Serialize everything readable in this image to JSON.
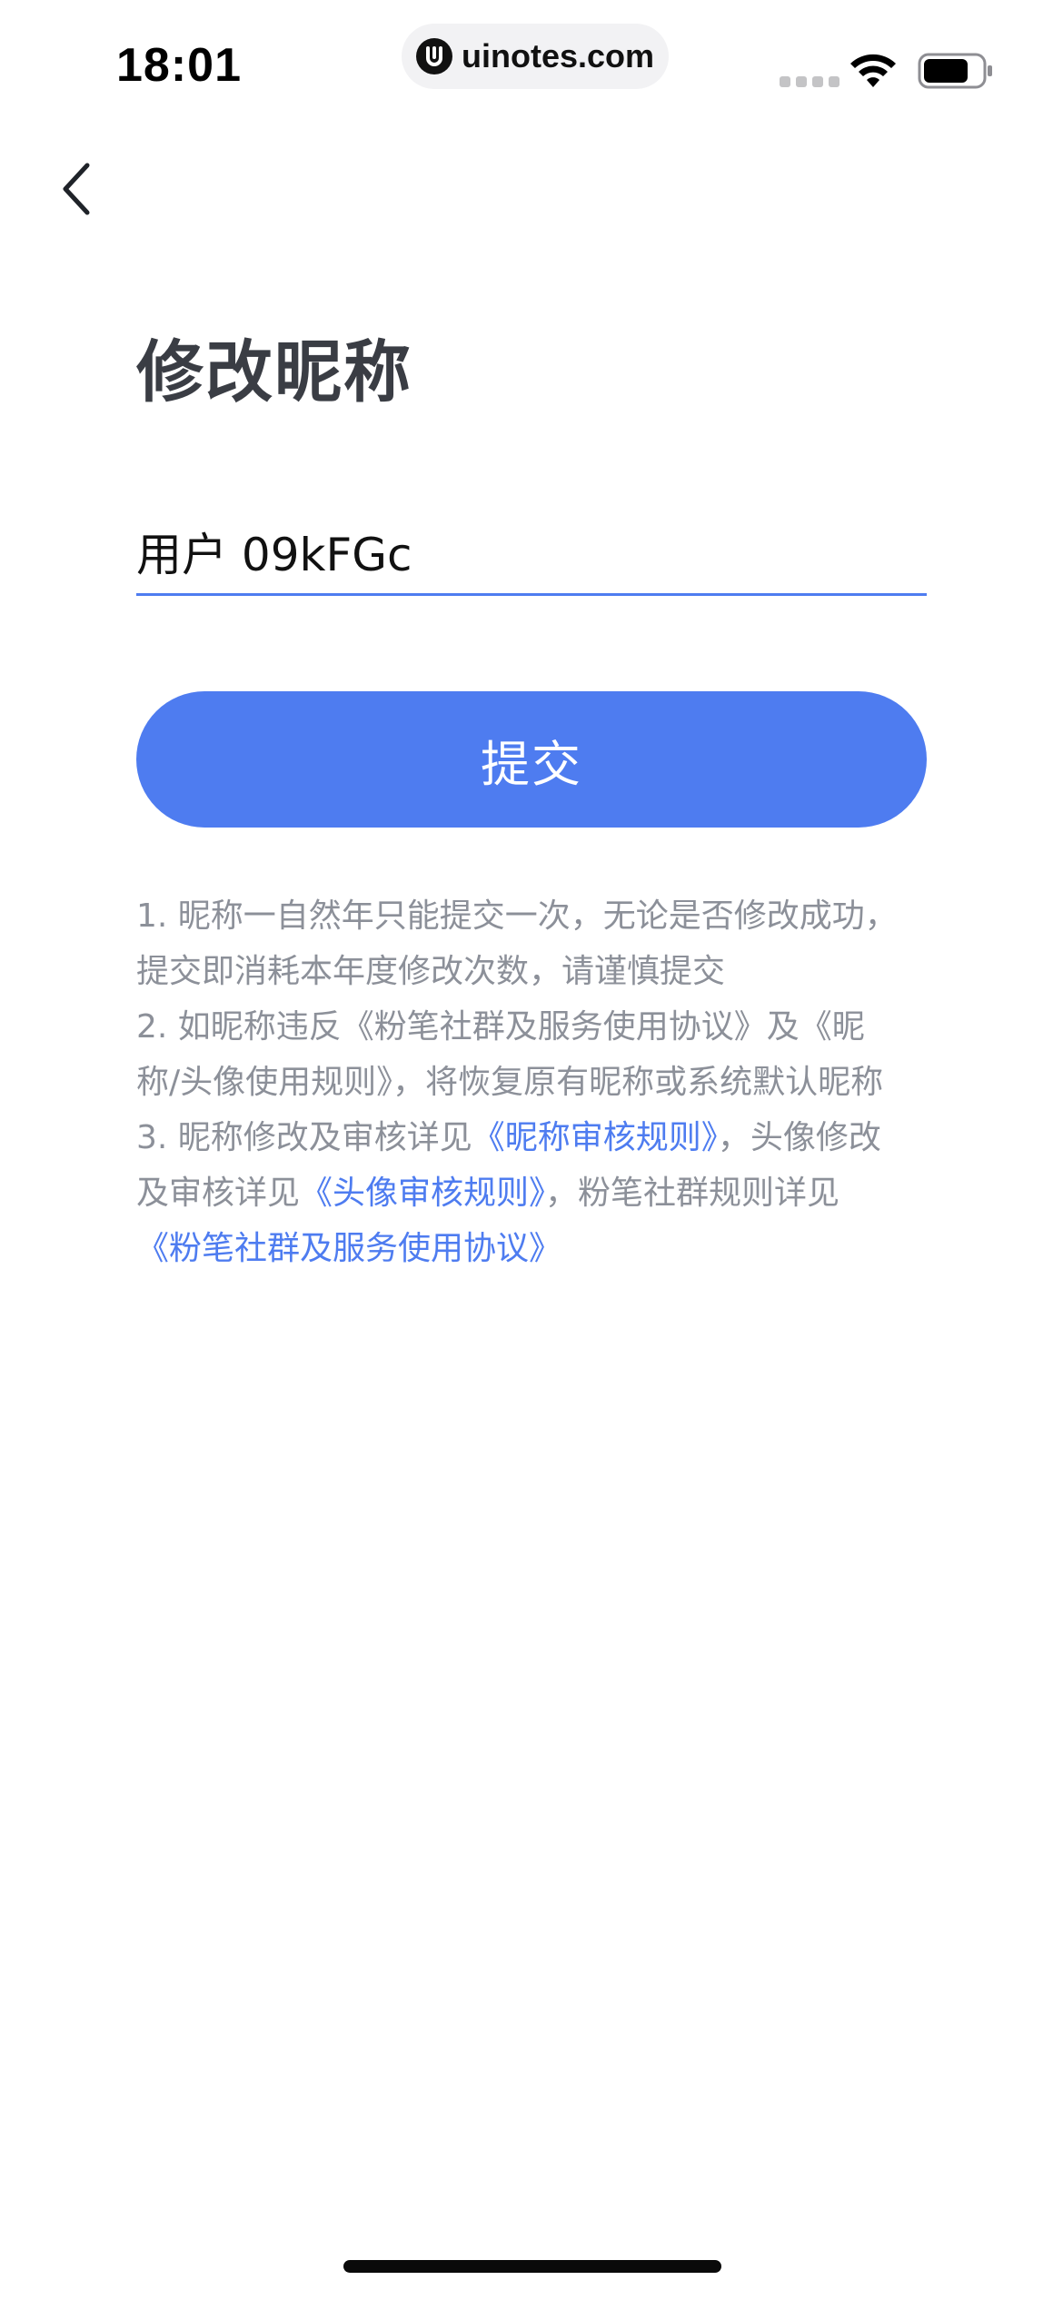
{
  "status_bar": {
    "time": "18:01",
    "url": "uinotes.com",
    "icons": [
      "signal-icon",
      "wifi-icon",
      "battery-icon"
    ]
  },
  "nav": {
    "back_icon": "chevron-left-icon"
  },
  "page": {
    "title": "修改昵称"
  },
  "form": {
    "nickname_value": "用户 09kFGc",
    "submit_label": "提交"
  },
  "notes": {
    "l1": "1. 昵称一自然年只能提交一次，无论是否修改成功，",
    "l2": "提交即消耗本年度修改次数，请谨慎提交",
    "l3": "2. 如昵称违反《粉笔社群及服务使用协议》及《昵",
    "l4": "称/头像使用规则》，将恢复原有昵称或系统默认昵称",
    "l5_prefix": "3. 昵称修改及审核详见",
    "l5_link": "《昵称审核规则》",
    "l5_suffix": "，头像修改",
    "l6_prefix": "及审核详见",
    "l6_link": "《头像审核规则》",
    "l6_suffix": "，粉笔社群规则详见",
    "l7_link": "《粉笔社群及服务使用协议》"
  },
  "colors": {
    "accent": "#4e7cf0",
    "note_text": "#8c9099",
    "title_text": "#3a3d44"
  }
}
